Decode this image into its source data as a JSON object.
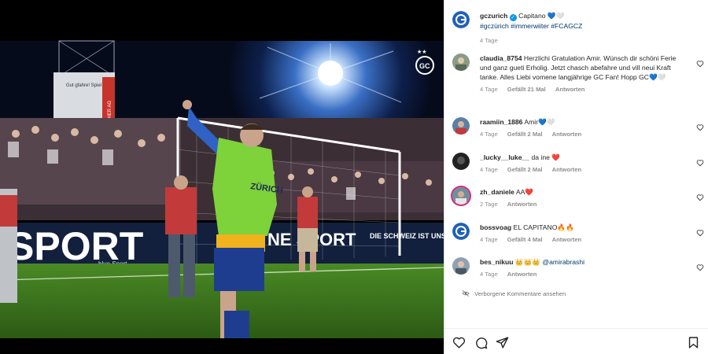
{
  "post": {
    "account": "gczurich",
    "caption": "Capitano 💙🤍",
    "tags": "#gczürich #immerwiiter #FCAGCZ",
    "age": "4 Tage"
  },
  "photo": {
    "banner_left": "SPORT",
    "banner_mid": "NE SPORT",
    "banner_right": "DIE SCHWEIZ IST UNSER",
    "bluesport": "blue Sport",
    "bib_text": "ZÜRICH",
    "stand_sign_1": "Gut gfahre! Spiel",
    "stand_sign_2": "BIRCHER AG",
    "club_logo": "GC"
  },
  "comments": [
    {
      "user": "claudia_8754",
      "text": "Herzlichi Gratulation Amir. Wünsch dir schöni Ferie und ganz gueti Erholig. Jetzt chasch abefahre und vill neui Kraft tanke. Alles Liebi vomene langjährige GC Fan! Hopp GC💙🤍",
      "age": "4 Tage",
      "likes": "Gefällt 21 Mal",
      "reply": "Antworten"
    },
    {
      "user": "raamiin_1886",
      "text": "Amir💙🤍",
      "age": "4 Tage",
      "likes": "Gefällt 2 Mal",
      "reply": "Antworten"
    },
    {
      "user": "_lucky__luke__",
      "text": "da ine ❤️",
      "age": "4 Tage",
      "likes": "Gefällt 2 Mal",
      "reply": "Antworten"
    },
    {
      "user": "zh_daniele",
      "text": "AA❤️",
      "age": "2 Tage",
      "likes": "",
      "reply": "Antworten"
    },
    {
      "user": "bossvoag",
      "text": "EL CAPITANO🔥🔥",
      "age": "4 Tage",
      "likes": "Gefällt 4 Mal",
      "reply": "Antworten"
    },
    {
      "user": "bes_nikuu",
      "text": "👑👑👑 ",
      "mention": "@amirabrashi",
      "age": "4 Tage",
      "likes": "",
      "reply": "Antworten"
    }
  ],
  "hidden_comments": "Verborgene Kommentare ansehen",
  "icons": {
    "like": "heart-icon",
    "comment": "comment-icon",
    "share": "send-icon",
    "save": "bookmark-icon",
    "verified": "verified-badge-icon",
    "eye_off": "eye-off-icon"
  },
  "colors": {
    "link_blue": "#00376b",
    "muted": "#8e8e8e",
    "verified": "#0095f6",
    "pitch_green": "#3d7a1f"
  }
}
